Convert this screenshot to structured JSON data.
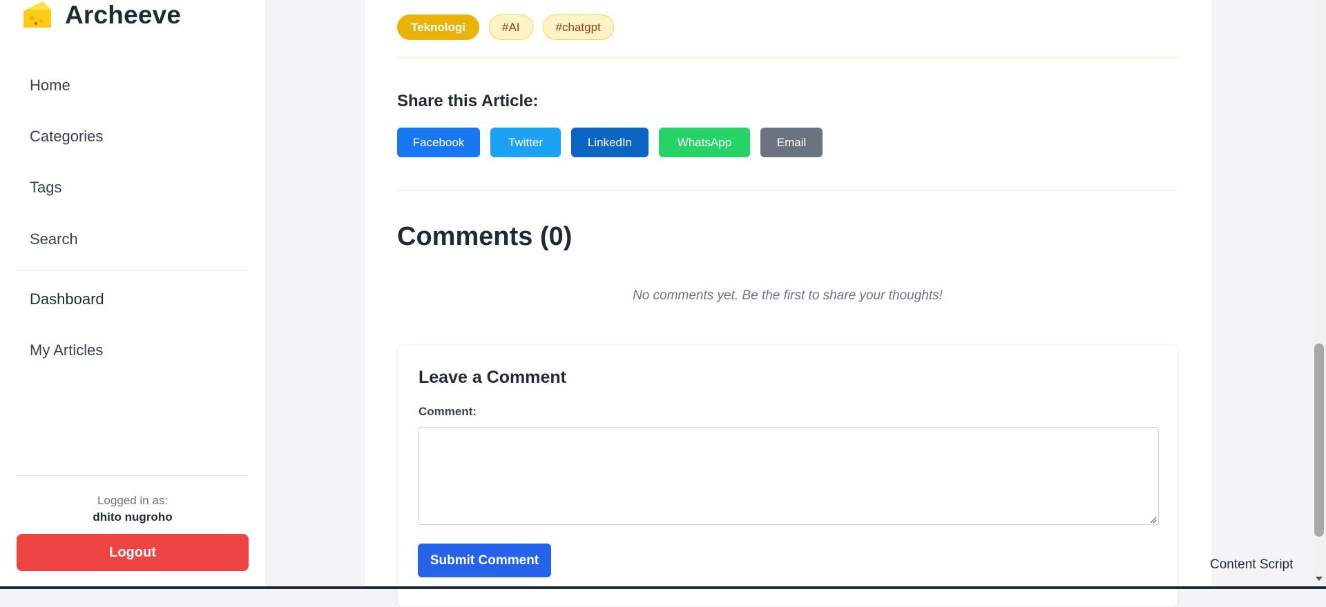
{
  "brand": {
    "name": "Archeeve",
    "logo_icon": "cheese-icon",
    "logo_color": "#facc15"
  },
  "sidebar": {
    "nav_primary": [
      {
        "label": "Home"
      },
      {
        "label": "Categories"
      },
      {
        "label": "Tags"
      },
      {
        "label": "Search"
      }
    ],
    "nav_secondary": [
      {
        "label": "Dashboard"
      },
      {
        "label": "My Articles"
      }
    ],
    "logged_in_label": "Logged in as:",
    "user_name": "dhito nugroho",
    "logout_label": "Logout",
    "logout_color": "#ef4444"
  },
  "article": {
    "category_tag": "Teknologi",
    "tags": [
      "#AI",
      "#chatgpt"
    ],
    "share": {
      "title": "Share this Article:",
      "buttons": [
        {
          "label": "Facebook",
          "color": "#1877f2"
        },
        {
          "label": "Twitter",
          "color": "#1da1f2"
        },
        {
          "label": "LinkedIn",
          "color": "#0a66c2"
        },
        {
          "label": "WhatsApp",
          "color": "#25d366"
        },
        {
          "label": "Email",
          "color": "#6b7280"
        }
      ]
    }
  },
  "comments": {
    "title": "Comments (0)",
    "empty_message": "No comments yet. Be the first to share your thoughts!",
    "form": {
      "title": "Leave a Comment",
      "comment_label": "Comment:",
      "comment_value": "",
      "submit_label": "Submit Comment",
      "submit_color": "#2563eb"
    }
  },
  "overlay": {
    "content_script_label": "Content Script"
  }
}
